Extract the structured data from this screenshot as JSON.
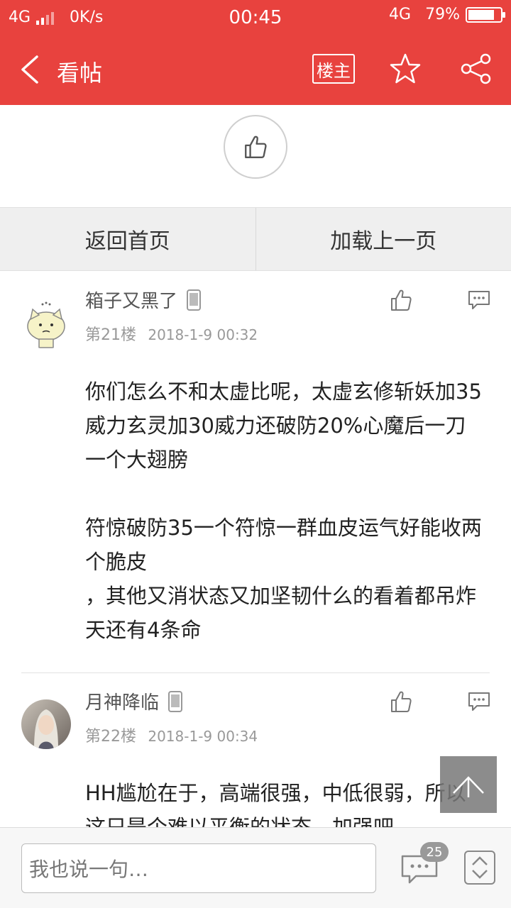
{
  "status_bar": {
    "network_left": "4G",
    "speed": "0K/s",
    "time": "00:45",
    "network_right": "4G",
    "battery": "79%",
    "battery_level": 0.79
  },
  "nav": {
    "title": "看帖",
    "owner_button": "楼主",
    "icons": [
      "back-icon",
      "star-icon",
      "share-icon"
    ]
  },
  "pager": {
    "home": "返回首页",
    "prev": "加载上一页"
  },
  "posts": [
    {
      "username": "箱子又黑了",
      "floor": "第21楼",
      "date": "2018-1-9 00:32",
      "paragraphs": [
        "你们怎么不和太虚比呢，太虚玄修斩妖加35威力玄灵加30威力还破防20%心魔后一刀一个大翅膀",
        "符惊破防35一个符惊一群血皮运气好能收两个脆皮\n，其他又消状态又加坚韧什么的看着都吊炸天还有4条命"
      ]
    },
    {
      "username": "月神降临",
      "floor": "第22楼",
      "date": "2018-1-9 00:34",
      "paragraphs": [
        "HH尴尬在于，高端很强，中低很弱，所以这只是个难以平衡的状态，加强吧"
      ]
    }
  ],
  "bottom": {
    "input_placeholder": "我也说一句…",
    "comment_count": "25"
  },
  "colors": {
    "brand_red": "#e8423e"
  }
}
